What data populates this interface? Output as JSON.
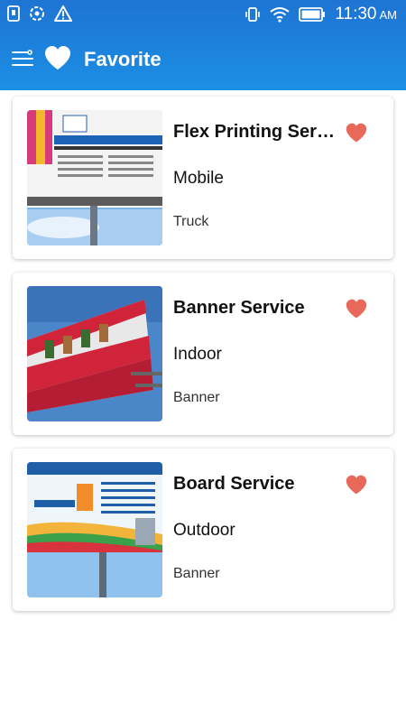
{
  "status_bar": {
    "time": "11:30",
    "ampm": "AM",
    "icons": [
      "sim-icon",
      "sync-icon",
      "warning-icon",
      "vibrate-icon",
      "wifi-icon",
      "battery-icon"
    ]
  },
  "header": {
    "title": "Favorite",
    "menu_icon": "menu-icon",
    "logo_icon": "heart-icon",
    "background": "#1e7ad8"
  },
  "favorites": [
    {
      "title": "Flex Printing Serv...",
      "category": "Mobile",
      "tag": "Truck",
      "favorite": true
    },
    {
      "title": "Banner Service",
      "category": "Indoor",
      "tag": "Banner",
      "favorite": true
    },
    {
      "title": "Board Service",
      "category": "Outdoor",
      "tag": "Banner",
      "favorite": true
    }
  ],
  "colors": {
    "heart": "#e8685a",
    "accent": "#1e7ad8"
  }
}
